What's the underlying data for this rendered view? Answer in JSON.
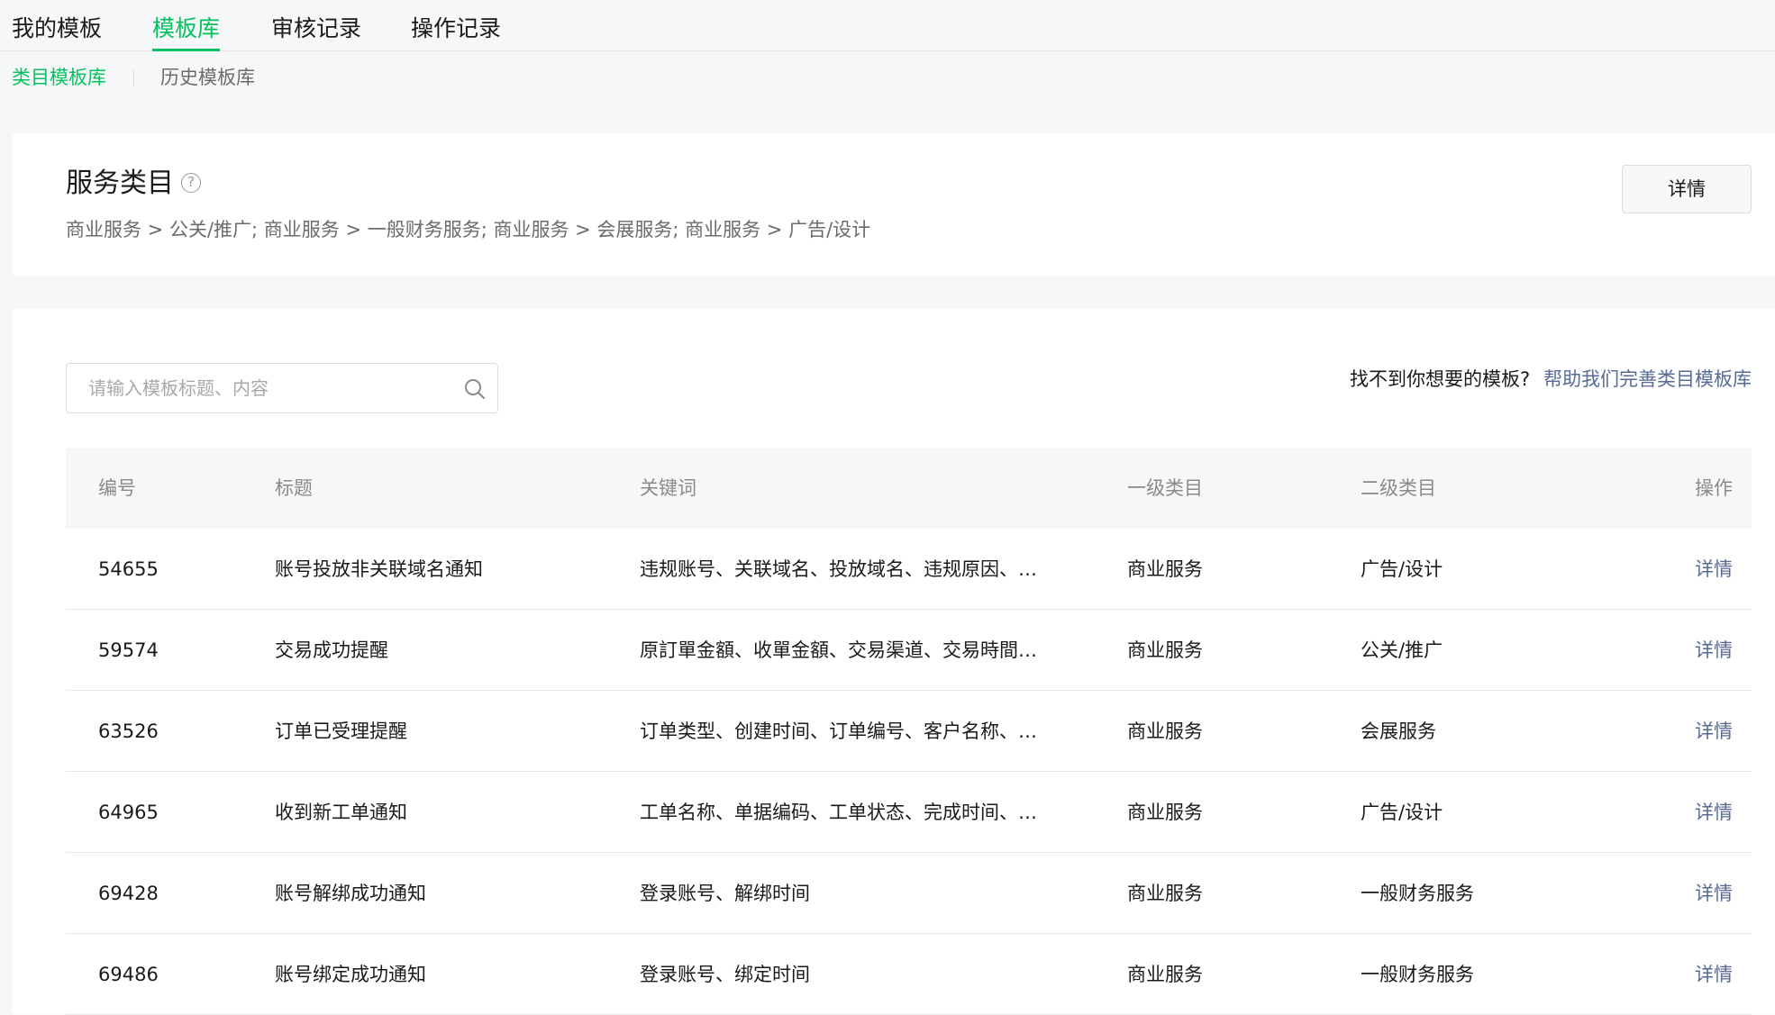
{
  "top_tabs": [
    {
      "label": "我的模板"
    },
    {
      "label": "模板库"
    },
    {
      "label": "审核记录"
    },
    {
      "label": "操作记录"
    }
  ],
  "sub_tabs": [
    {
      "label": "类目模板库"
    },
    {
      "label": "历史模板库"
    }
  ],
  "category": {
    "title": "服务类目",
    "help_icon": "?",
    "path": "商业服务 > 公关/推广; 商业服务 > 一般财务服务; 商业服务 > 会展服务; 商业服务 > 广告/设计",
    "detail_button": "详情"
  },
  "search": {
    "placeholder": "请输入模板标题、内容"
  },
  "help": {
    "text": "找不到你想要的模板?",
    "link": "帮助我们完善类目模板库"
  },
  "table": {
    "headers": {
      "id": "编号",
      "title": "标题",
      "keywords": "关键词",
      "level1": "一级类目",
      "level2": "二级类目",
      "action": "操作"
    },
    "rows": [
      {
        "id": "54655",
        "title": "账号投放非关联域名通知",
        "keywords": "违规账号、关联域名、投放域名、违规原因、违...",
        "level1": "商业服务",
        "level2": "广告/设计",
        "action": "详情"
      },
      {
        "id": "59574",
        "title": "交易成功提醒",
        "keywords": "原訂單金額、收單金額、交易渠道、交易時間、...",
        "level1": "商业服务",
        "level2": "公关/推广",
        "action": "详情"
      },
      {
        "id": "63526",
        "title": "订单已受理提醒",
        "keywords": "订单类型、创建时间、订单编号、客户名称、联...",
        "level1": "商业服务",
        "level2": "会展服务",
        "action": "详情"
      },
      {
        "id": "64965",
        "title": "收到新工单通知",
        "keywords": "工单名称、单据编码、工单状态、完成时间、部...",
        "level1": "商业服务",
        "level2": "广告/设计",
        "action": "详情"
      },
      {
        "id": "69428",
        "title": "账号解绑成功通知",
        "keywords": "登录账号、解绑时间",
        "level1": "商业服务",
        "level2": "一般财务服务",
        "action": "详情"
      },
      {
        "id": "69486",
        "title": "账号绑定成功通知",
        "keywords": "登录账号、绑定时间",
        "level1": "商业服务",
        "level2": "一般财务服务",
        "action": "详情"
      }
    ]
  },
  "colors": {
    "accent": "#07c160",
    "link": "#576b95"
  }
}
